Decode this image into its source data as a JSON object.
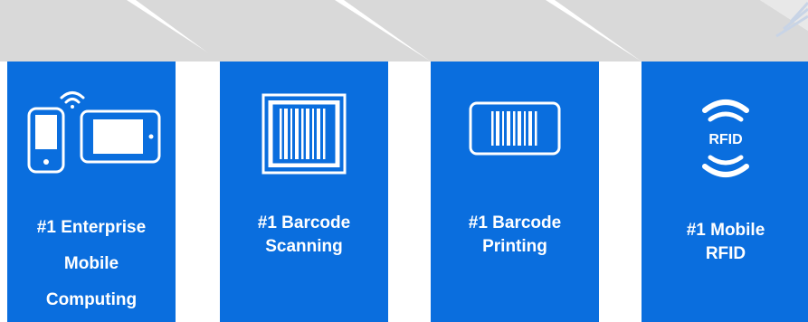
{
  "cards": [
    {
      "icon": "mobile-computer-and-tablet-icon",
      "label_lines": [
        "#1 Enterprise",
        "Mobile",
        "Computing"
      ]
    },
    {
      "icon": "barcode-scanning-icon",
      "label_lines": [
        "#1 Barcode",
        "Scanning"
      ]
    },
    {
      "icon": "barcode-printing-icon",
      "label_lines": [
        "#1 Barcode",
        "Printing"
      ]
    },
    {
      "icon": "rfid-icon",
      "icon_text": "RFID",
      "label_lines": [
        "#1 Mobile",
        "RFID"
      ]
    }
  ],
  "colors": {
    "card": "#0a6ede",
    "band": "#d9d9d9",
    "text": "#ffffff"
  }
}
